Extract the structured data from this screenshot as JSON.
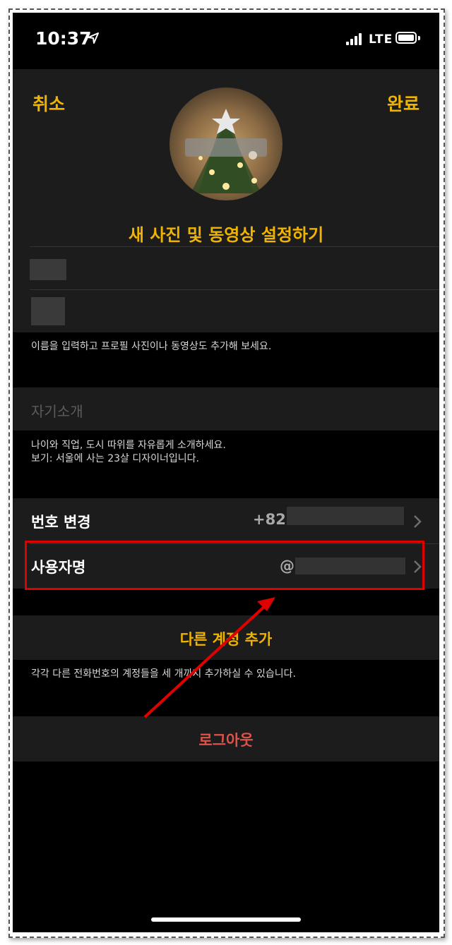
{
  "status_bar": {
    "time": "10:37",
    "network": "LTE"
  },
  "header": {
    "cancel": "취소",
    "done": "완료",
    "set_photo": "새 사진 및 동영상 설정하기"
  },
  "name_hint": "이름을 입력하고 프로필 사진이나 동영상도 추가해 보세요.",
  "bio": {
    "placeholder": "자기소개",
    "hint_line1": "나이와 직업, 도시 따위를 자유롭게 소개하세요.",
    "hint_line2": "보기: 서울에 사는 23살 디자이너입니다."
  },
  "phone_row": {
    "label": "번호 변경",
    "value": "+82"
  },
  "username_row": {
    "label": "사용자명",
    "value": "@"
  },
  "add_account": {
    "label": "다른 계정 추가",
    "hint": "각각 다른 전화번호의 계정들을 세 개까지 추가하실 수 있습니다."
  },
  "logout": {
    "label": "로그아웃"
  },
  "colors": {
    "accent": "#f0b400",
    "danger": "#e0524a",
    "annotation": "#e00000"
  }
}
